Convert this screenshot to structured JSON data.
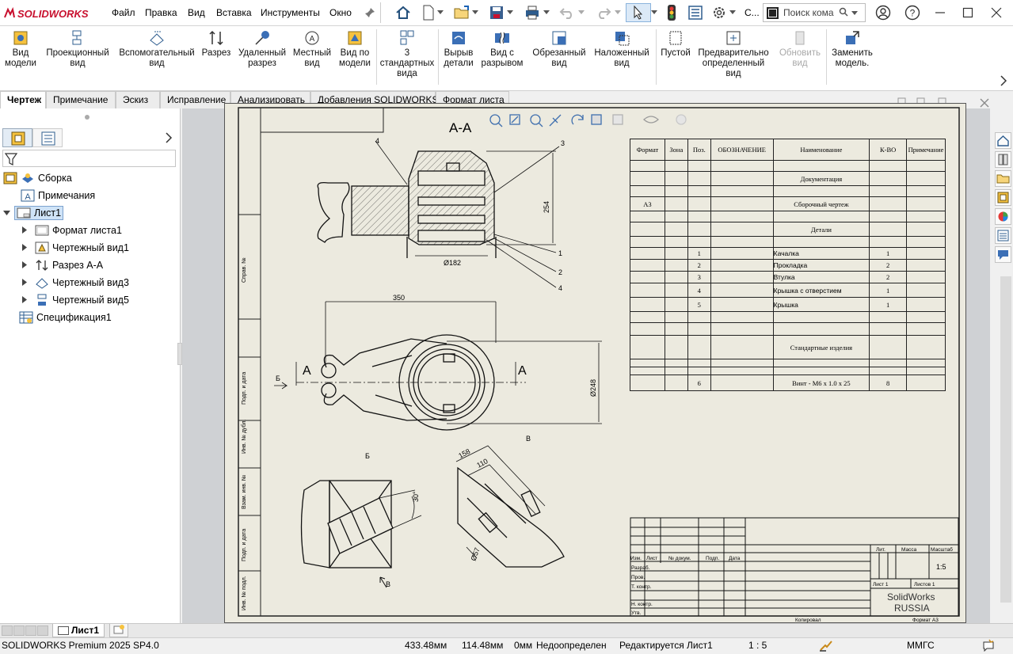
{
  "app": {
    "brand": "SOLIDWORKS"
  },
  "menu": {
    "items": [
      "Файл",
      "Правка",
      "Вид",
      "Вставка",
      "Инструменты",
      "Окно"
    ]
  },
  "quick_access": {
    "overflow_label": "С...",
    "search_placeholder": "Поиск кома"
  },
  "ribbon": {
    "buttons": [
      {
        "label": "Вид\nмодели",
        "icon": "model-view-icon",
        "enabled": true
      },
      {
        "label": "Проекционный\nвид",
        "icon": "projected-view-icon",
        "enabled": true
      },
      {
        "label": "Вспомогательный\nвид",
        "icon": "auxiliary-view-icon",
        "enabled": true
      },
      {
        "label": "Разрез",
        "icon": "section-view-icon",
        "enabled": true
      },
      {
        "label": "Удаленный\nразрез",
        "icon": "removed-section-icon",
        "enabled": true
      },
      {
        "label": "Местный\nвид",
        "icon": "detail-view-icon",
        "enabled": true
      },
      {
        "label": "Вид по\nмодели",
        "icon": "model-based-view-icon",
        "enabled": true
      },
      {
        "label": "3\nстандартных\nвида",
        "icon": "standard-3-view-icon",
        "enabled": true
      },
      {
        "label": "Вырыв\nдетали",
        "icon": "break-out-section-icon",
        "enabled": true
      },
      {
        "label": "Вид с\nразрывом",
        "icon": "broken-view-icon",
        "enabled": true
      },
      {
        "label": "Обрезанный\nвид",
        "icon": "crop-view-icon",
        "enabled": true
      },
      {
        "label": "Наложенный\nвид",
        "icon": "alternate-position-icon",
        "enabled": true
      },
      {
        "label": "Пустой",
        "icon": "empty-view-icon",
        "enabled": true
      },
      {
        "label": "Предварительно\nопределенный\nвид",
        "icon": "predefined-view-icon",
        "enabled": true
      },
      {
        "label": "Обновить\nвид",
        "icon": "update-view-icon",
        "enabled": false
      },
      {
        "label": "Заменить\nмодель.",
        "icon": "replace-model-icon",
        "enabled": true
      }
    ]
  },
  "tabs": [
    "Чертеж",
    "Примечание",
    "Эскиз",
    "Исправление",
    "Анализировать",
    "Добавления SOLIDWORKS",
    "Формат листа"
  ],
  "active_tab": "Чертеж",
  "tree": {
    "root": "Сборка",
    "items": [
      {
        "label": "Примечания",
        "level": 1
      },
      {
        "label": "Лист1",
        "level": 1,
        "selected": true
      },
      {
        "label": "Формат листа1",
        "level": 2
      },
      {
        "label": "Чертежный вид1",
        "level": 2
      },
      {
        "label": "Разрез А-А",
        "level": 2
      },
      {
        "label": "Чертежный вид3",
        "level": 2
      },
      {
        "label": "Чертежный вид5",
        "level": 2
      },
      {
        "label": "Спецификация1",
        "level": 1
      }
    ]
  },
  "drawing": {
    "section_title": "А-А",
    "dims": {
      "d182": "Ø182",
      "h254": "254",
      "w350": "350",
      "d248": "Ø248",
      "l158": "158",
      "l110": "110",
      "d57": "Ø57",
      "a30": "30°"
    },
    "callouts": [
      "1",
      "2",
      "3",
      "4"
    ],
    "view_labels": {
      "b": "Б",
      "v": "В",
      "a": "А"
    },
    "left_column": [
      "Справ. №",
      "Подп. и дата",
      "Инв. № дубл.",
      "Взам. инв. №",
      "Подп. и дата",
      "Инв. № подл."
    ]
  },
  "spec": {
    "headers": [
      "Формат",
      "Зона",
      "Поз.",
      "ОБОЗНАЧЕНИЕ",
      "Наименование",
      "К-ВО",
      "Примечание"
    ],
    "rows": [
      {
        "format": "",
        "zone": "",
        "pos": "",
        "des": "",
        "name": "Документация",
        "qty": "",
        "note": ""
      },
      {
        "format": "А3",
        "zone": "",
        "pos": "",
        "des": "",
        "name": "Сборочный чертеж",
        "qty": "",
        "note": ""
      },
      {
        "format": "",
        "zone": "",
        "pos": "",
        "des": "",
        "name": "Детали",
        "qty": "",
        "note": ""
      },
      {
        "format": "",
        "zone": "",
        "pos": "1",
        "des": "",
        "name": "Качалка",
        "qty": "1",
        "note": ""
      },
      {
        "format": "",
        "zone": "",
        "pos": "2",
        "des": "",
        "name": "Прокладка",
        "qty": "2",
        "note": ""
      },
      {
        "format": "",
        "zone": "",
        "pos": "3",
        "des": "",
        "name": "Втулка",
        "qty": "2",
        "note": ""
      },
      {
        "format": "",
        "zone": "",
        "pos": "4",
        "des": "",
        "name": "Крышка с отверстием",
        "qty": "1",
        "note": ""
      },
      {
        "format": "",
        "zone": "",
        "pos": "5",
        "des": "",
        "name": "Крышка",
        "qty": "1",
        "note": ""
      },
      {
        "format": "",
        "zone": "",
        "pos": "",
        "des": "",
        "name": "Стандартные изделия",
        "qty": "",
        "note": ""
      },
      {
        "format": "",
        "zone": "",
        "pos": "6",
        "des": "",
        "name": "Винт - М6 x 1.0 x 25",
        "qty": "8",
        "note": ""
      }
    ]
  },
  "title_block": {
    "cols": [
      "Изм.",
      "Лист",
      "№ докум.",
      "Подп.",
      "Дата"
    ],
    "rows": [
      "Разраб.",
      "Пров.",
      "Т. контр.",
      "",
      "Н. контр.",
      "Утв."
    ],
    "lit": "Лит.",
    "mass": "Масса",
    "scale_label": "Масштаб",
    "scale": "1:5",
    "sheet": "Лист 1",
    "sheets": "Листов 1",
    "company": "SolidWorks\nRUSSIA",
    "copied": "Копировал",
    "format": "Формат А3"
  },
  "bottom": {
    "sheet_tab": "Лист1"
  },
  "status": {
    "product": "SOLIDWORKS Premium 2025 SP4.0",
    "x": "433.48мм",
    "y": "114.48мм",
    "z": "0мм",
    "state": "Недоопределен",
    "editing": "Редактируется Лист1",
    "scale": "1 : 5",
    "units": "ММГС"
  },
  "colors": {
    "sheet_bg": "#eceadf",
    "selection": "#cfe3f7",
    "brand": "#c8102e"
  }
}
